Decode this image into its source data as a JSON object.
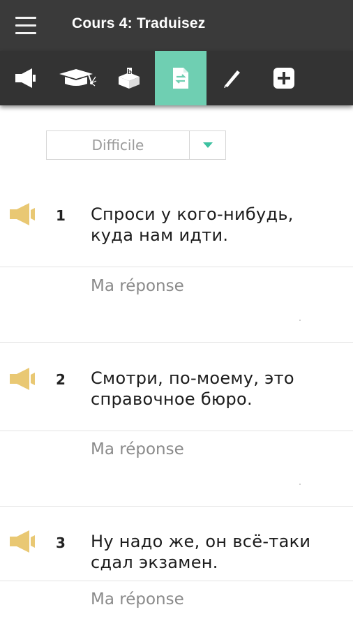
{
  "header": {
    "title": "Cours 4: Traduisez",
    "menu_icon": "hamburger-menu-icon"
  },
  "toolbar": {
    "active_index": 3,
    "accent_color": "#6fcfb2",
    "tools": [
      {
        "name": "speaker-icon"
      },
      {
        "name": "graduation-cap-icon"
      },
      {
        "name": "box-tray-icon"
      },
      {
        "name": "document-swap-icon"
      },
      {
        "name": "pen-icon"
      },
      {
        "name": "plus-square-icon"
      }
    ]
  },
  "level": {
    "selected": "Difficile",
    "arrow_color": "#3cc1a0"
  },
  "exercises": [
    {
      "number": "1",
      "sentence": "Спроси у кого-нибудь, куда нам идти.",
      "answer_placeholder": "Ma réponse",
      "answer_value": ""
    },
    {
      "number": "2",
      "sentence": "Смотри, по-моему, это справочное бюро.",
      "answer_placeholder": "Ma réponse",
      "answer_value": ""
    },
    {
      "number": "3",
      "sentence": "Ну надо же, он всё-таки сдал экзамен.",
      "answer_placeholder": "Ma réponse",
      "answer_value": ""
    }
  ],
  "speaker_color": "#e9c873"
}
